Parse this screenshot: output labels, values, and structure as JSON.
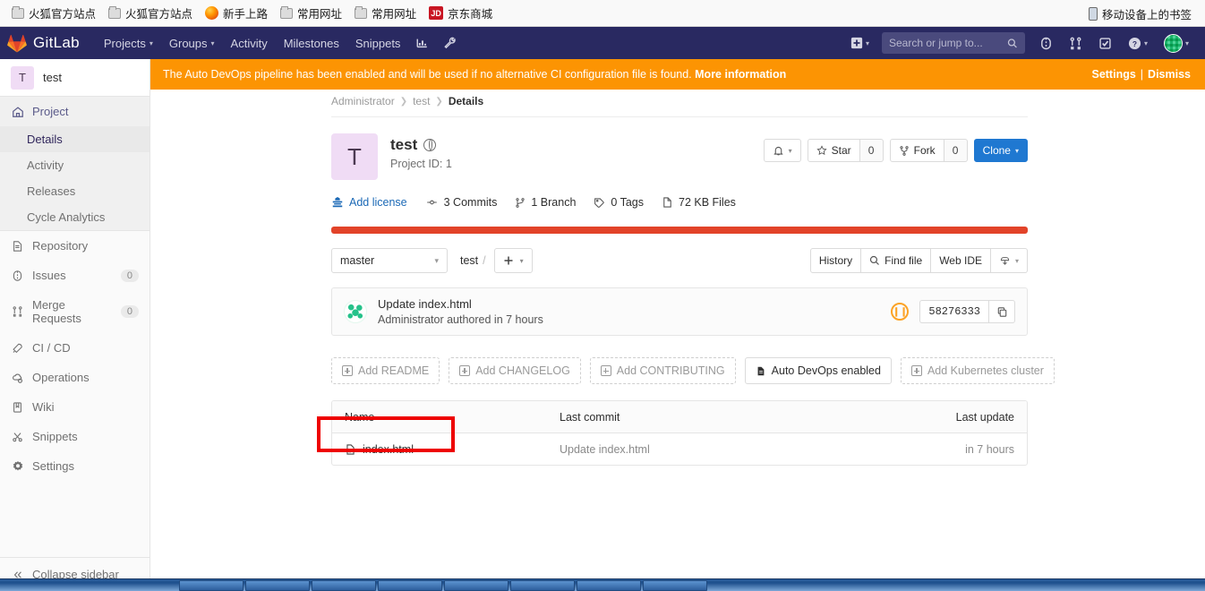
{
  "browser": {
    "bookmarks": [
      {
        "label": "火狐官方站点",
        "icon": "folder-icon"
      },
      {
        "label": "火狐官方站点",
        "icon": "folder-icon"
      },
      {
        "label": "新手上路",
        "icon": "firefox-icon"
      },
      {
        "label": "常用网址",
        "icon": "folder-icon"
      },
      {
        "label": "常用网址",
        "icon": "folder-icon"
      },
      {
        "label": "京东商城",
        "icon": "jd-icon",
        "badge": "JD"
      }
    ],
    "mobile_bookmarks": {
      "label": "移动设备上的书签",
      "icon": "mobile-device-icon"
    }
  },
  "navbar": {
    "brand": "GitLab",
    "links": [
      {
        "label": "Projects",
        "has_caret": true
      },
      {
        "label": "Groups",
        "has_caret": true
      },
      {
        "label": "Activity",
        "has_caret": false
      },
      {
        "label": "Milestones",
        "has_caret": false
      },
      {
        "label": "Snippets",
        "has_caret": false
      }
    ],
    "icon_buttons": [
      {
        "name": "analytics-chart-icon"
      },
      {
        "name": "wrench-admin-icon"
      }
    ],
    "plus_button": "plus-new-icon",
    "search": {
      "placeholder": "Search or jump to...",
      "value": ""
    },
    "right_icons": [
      {
        "name": "issues-icon"
      },
      {
        "name": "merge-requests-icon"
      },
      {
        "name": "todos-icon"
      },
      {
        "name": "help-icon"
      }
    ],
    "avatar": "user-avatar"
  },
  "alert": {
    "text": "The Auto DevOps pipeline has been enabled and will be used if no alternative CI configuration file is found.",
    "link": "More information",
    "settings": "Settings",
    "separator": "|",
    "dismiss": "Dismiss",
    "background": "#fc9403"
  },
  "sidebar": {
    "project": {
      "initial": "T",
      "name": "test"
    },
    "items": [
      {
        "label": "Project",
        "icon": "home-icon",
        "type": "group-header"
      },
      {
        "label": "Details",
        "type": "sub",
        "active": true
      },
      {
        "label": "Activity",
        "type": "sub",
        "active": false
      },
      {
        "label": "Releases",
        "type": "sub",
        "active": false
      },
      {
        "label": "Cycle Analytics",
        "type": "sub",
        "active": false
      },
      {
        "label": "Repository",
        "icon": "document-icon",
        "type": "item"
      },
      {
        "label": "Issues",
        "icon": "issues-icon",
        "type": "item",
        "count": "0"
      },
      {
        "label": "Merge Requests",
        "icon": "merge-icon",
        "type": "item",
        "count": "0"
      },
      {
        "label": "CI / CD",
        "icon": "rocket-icon",
        "type": "item"
      },
      {
        "label": "Operations",
        "icon": "cloud-gear-icon",
        "type": "item"
      },
      {
        "label": "Wiki",
        "icon": "book-icon",
        "type": "item"
      },
      {
        "label": "Snippets",
        "icon": "scissors-icon",
        "type": "item"
      },
      {
        "label": "Settings",
        "icon": "gear-icon",
        "type": "item"
      }
    ],
    "collapse": {
      "label": "Collapse sidebar",
      "icon": "chevrons-left-icon"
    }
  },
  "breadcrumb": {
    "owner": "Administrator",
    "project": "test",
    "page": "Details"
  },
  "project": {
    "initial": "T",
    "title": "test",
    "visibility_icon": "globe-public-icon",
    "project_id": "Project ID: 1",
    "notification_icon": "bell-icon",
    "star": {
      "label": "Star",
      "count": "0",
      "icon": "star-icon"
    },
    "fork": {
      "label": "Fork",
      "count": "0",
      "icon": "fork-icon"
    },
    "clone": {
      "label": "Clone",
      "caret": true
    }
  },
  "stats": [
    {
      "label": "Add license",
      "icon": "license-icon",
      "is_link": true
    },
    {
      "label": "3 Commits",
      "icon": "commit-icon",
      "is_link": false
    },
    {
      "label": "1 Branch",
      "icon": "branch-icon",
      "is_link": false
    },
    {
      "label": "0 Tags",
      "icon": "tag-icon",
      "is_link": false
    },
    {
      "label": "72 KB Files",
      "icon": "files-icon",
      "is_link": false
    }
  ],
  "language_bar_color": "#e24329",
  "repo_toolbar": {
    "branch": "master",
    "path_root": "test",
    "path_sep": "/",
    "add_button_icon": "plus-icon",
    "buttons": [
      {
        "label": "History",
        "icon": null
      },
      {
        "label": "Find file",
        "icon": "search-icon"
      },
      {
        "label": "Web IDE",
        "icon": null
      }
    ],
    "download_icon": "download-icon"
  },
  "commit": {
    "title": "Update index.html",
    "subtitle": "Administrator authored in 7 hours",
    "pipeline_status": "pending",
    "pipeline_icon": "pipeline-pending-icon",
    "sha": "58276333",
    "copy_icon": "copy-icon"
  },
  "add_buttons": [
    {
      "label": "Add README",
      "style": "dashed",
      "icon": "plus-box-icon"
    },
    {
      "label": "Add CHANGELOG",
      "style": "dashed",
      "icon": "plus-box-icon"
    },
    {
      "label": "Add CONTRIBUTING",
      "style": "dashed",
      "icon": "plus-box-icon"
    },
    {
      "label": "Auto DevOps enabled",
      "style": "solid",
      "icon": "document-icon"
    },
    {
      "label": "Add Kubernetes cluster",
      "style": "dashed",
      "icon": "plus-box-icon"
    }
  ],
  "file_table": {
    "headers": {
      "name": "Name",
      "last_commit": "Last commit",
      "last_update": "Last update"
    },
    "rows": [
      {
        "name": "index.html",
        "icon": "file-code-icon",
        "last_commit": "Update index.html",
        "last_update": "in 7 hours",
        "highlighted": true
      }
    ]
  },
  "annotation": {
    "color": "#ee0000",
    "target": "index.html"
  }
}
